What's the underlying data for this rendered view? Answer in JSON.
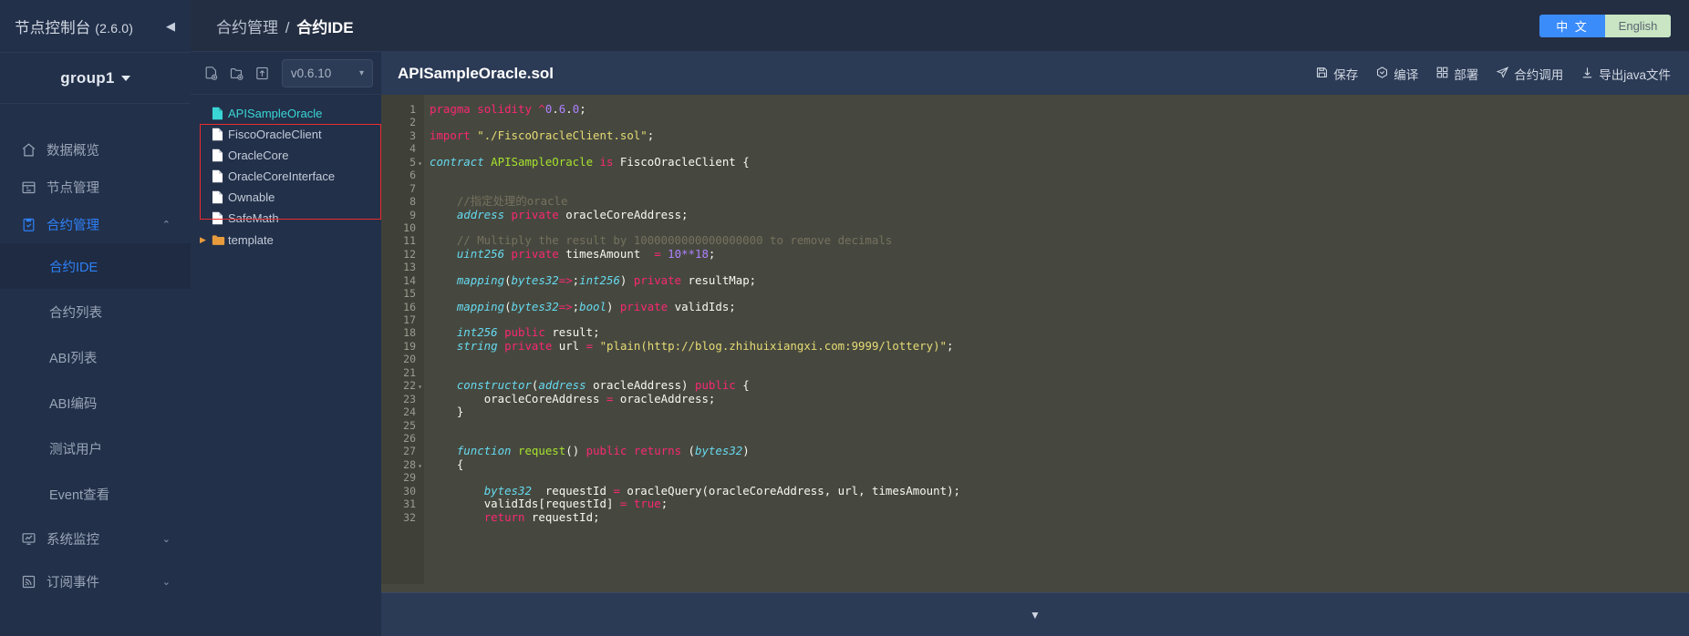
{
  "sidebar": {
    "title": "节点控制台",
    "version": "(2.6.0)",
    "collapse_icon": "chevron-left-icon",
    "group": "group1",
    "items": [
      {
        "label": "数据概览",
        "icon": "home-icon",
        "active": false
      },
      {
        "label": "节点管理",
        "icon": "calendar-icon",
        "active": false
      },
      {
        "label": "合约管理",
        "icon": "clipboard-check-icon",
        "active": true,
        "chevron": "⌃"
      }
    ],
    "sub_items": [
      {
        "label": "合约IDE",
        "selected": true
      },
      {
        "label": "合约列表",
        "selected": false
      },
      {
        "label": "ABI列表",
        "selected": false
      },
      {
        "label": "ABI编码",
        "selected": false
      },
      {
        "label": "测试用户",
        "selected": false
      },
      {
        "label": "Event查看",
        "selected": false
      }
    ],
    "bottom_items": [
      {
        "label": "系统监控",
        "icon": "monitor-chart-icon",
        "chevron": "⌄"
      },
      {
        "label": "订阅事件",
        "icon": "rss-icon",
        "chevron": "⌄"
      }
    ]
  },
  "header": {
    "breadcrumb_parent": "合约管理",
    "breadcrumb_sep": "/",
    "breadcrumb_current": "合约IDE",
    "lang_zh": "中 文",
    "lang_en": "English",
    "lang_active": "中 文"
  },
  "file_panel": {
    "toolbar": [
      {
        "name": "new-file-icon",
        "title": "新建文件"
      },
      {
        "name": "new-folder-icon",
        "title": "新建文件夹"
      },
      {
        "name": "upload-icon",
        "title": "导入"
      }
    ],
    "version_select": {
      "value": "v0.6.10",
      "chevron": "⌄"
    },
    "tree": [
      {
        "label": "APISampleOracle",
        "type": "file",
        "selected": true,
        "depth": 0
      },
      {
        "label": "FiscoOracleClient",
        "type": "file",
        "selected": false,
        "depth": 1
      },
      {
        "label": "OracleCore",
        "type": "file",
        "selected": false,
        "depth": 1
      },
      {
        "label": "OracleCoreInterface",
        "type": "file",
        "selected": false,
        "depth": 1
      },
      {
        "label": "Ownable",
        "type": "file",
        "selected": false,
        "depth": 1
      },
      {
        "label": "SafeMath",
        "type": "file",
        "selected": false,
        "depth": 1
      },
      {
        "label": "template",
        "type": "folder",
        "selected": false,
        "depth": 0,
        "twisty": "▶"
      }
    ],
    "highlight_color": "#ee2b2b"
  },
  "editor": {
    "filename": "APISampleOracle.sol",
    "actions": [
      {
        "label": "保存",
        "icon": "save-icon"
      },
      {
        "label": "编译",
        "icon": "compile-icon"
      },
      {
        "label": "部署",
        "icon": "deploy-grid-icon"
      },
      {
        "label": "合约调用",
        "icon": "send-plane-icon"
      },
      {
        "label": "导出java文件",
        "icon": "download-icon"
      }
    ],
    "line_numbers": [
      1,
      2,
      3,
      4,
      5,
      6,
      7,
      8,
      9,
      10,
      11,
      12,
      13,
      14,
      15,
      16,
      17,
      18,
      19,
      20,
      21,
      22,
      23,
      24,
      25,
      26,
      27,
      28,
      29,
      30,
      31,
      32
    ],
    "fold_lines": [
      5,
      22,
      28
    ],
    "code_lines": [
      "pragma solidity ^0.6.0;",
      "",
      "import \"./FiscoOracleClient.sol\";",
      "",
      "contract APISampleOracle is FiscoOracleClient {",
      "",
      "",
      "    //指定处理的oracle",
      "    address private oracleCoreAddress;",
      "",
      "    // Multiply the result by 1000000000000000000 to remove decimals",
      "    uint256 private timesAmount  = 10**18;",
      "",
      "    mapping(bytes32=>int256) private resultMap;",
      "",
      "    mapping(bytes32=>bool) private validIds;",
      "",
      "    int256 public result;",
      "    string private url = \"plain(http://blog.zhihuixiangxi.com:9999/lottery)\";",
      "",
      "",
      "    constructor(address oracleAddress) public {",
      "        oracleCoreAddress = oracleAddress;",
      "    }",
      "",
      "",
      "    function request() public returns (bytes32)",
      "    {",
      "",
      "        bytes32  requestId = oracleQuery(oracleCoreAddress, url, timesAmount);",
      "        validIds[requestId] = true;",
      "        return requestId;"
    ],
    "footer_chevron": "▼"
  },
  "colors": {
    "sidebar_bg": "#22304a",
    "main_bg": "#2b3a55",
    "topbar_bg": "#242e42",
    "accent_blue": "#2f80f7",
    "lang_active_bg": "#3b8cfb",
    "lang_inactive_bg": "#c9e5c4",
    "editor_bg": "#46483f",
    "gutter_bg": "#3f4138",
    "tree_root": "#3ad6d6",
    "folder_orange": "#e89b3c"
  }
}
